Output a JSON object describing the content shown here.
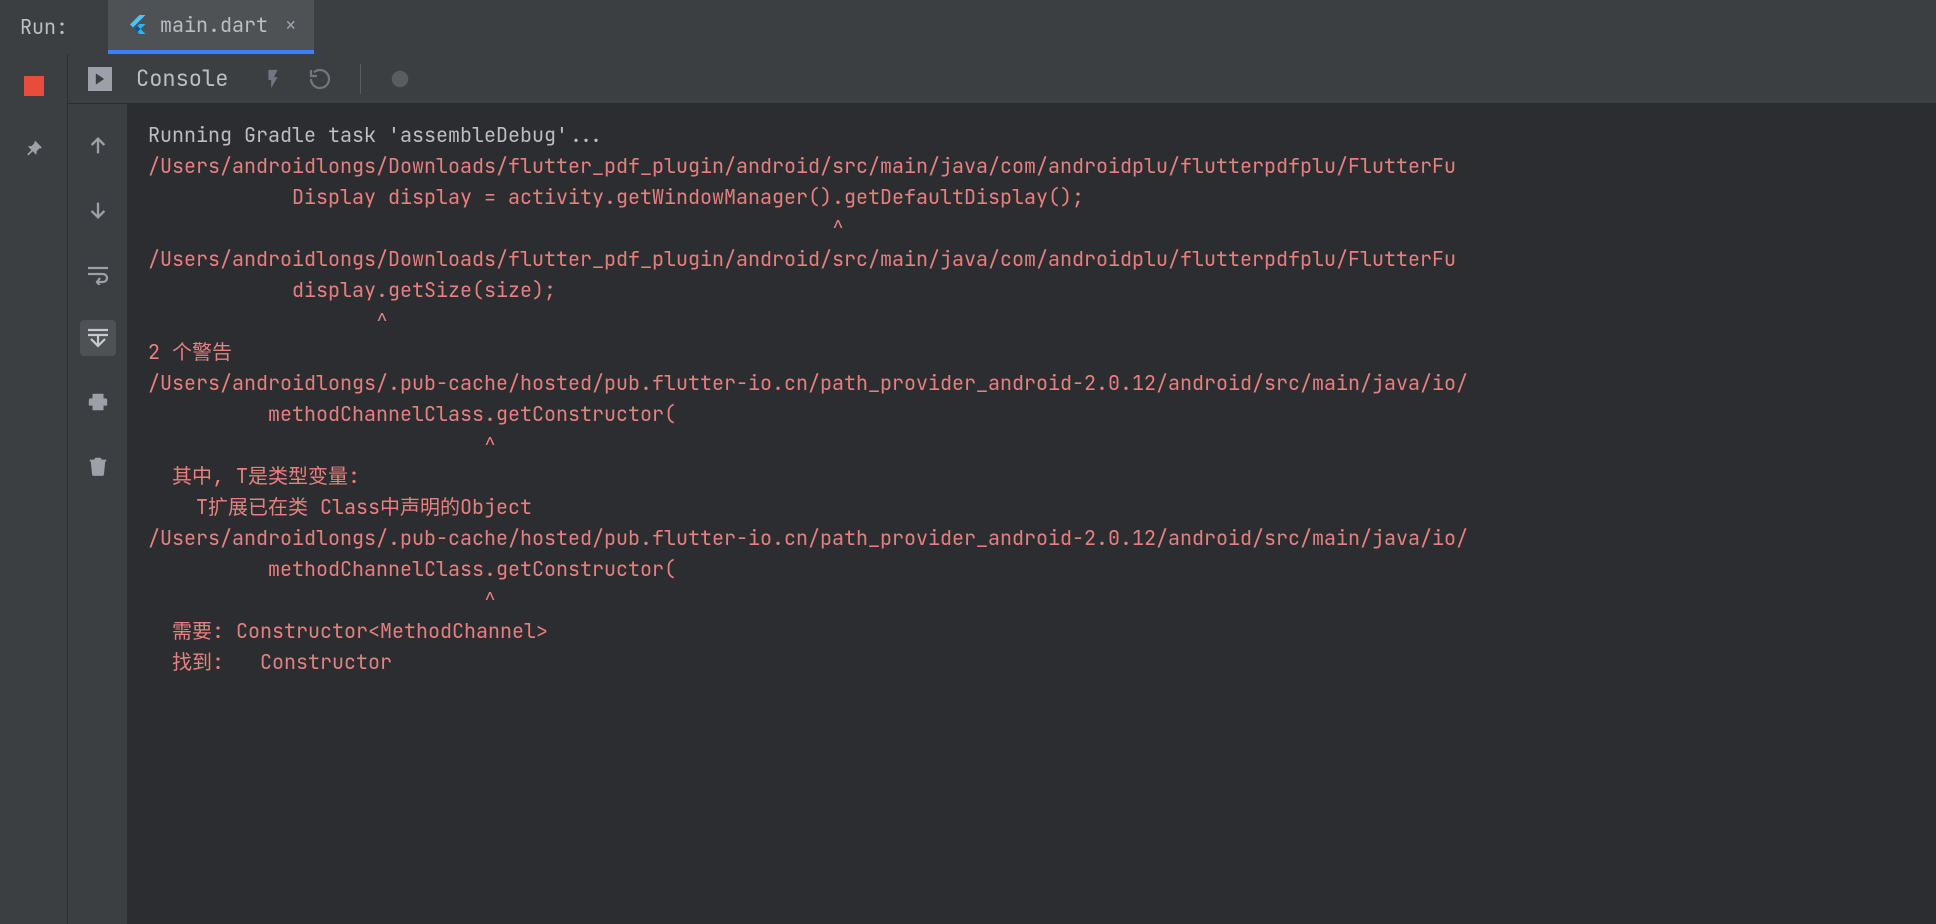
{
  "header": {
    "run_label": "Run:",
    "tab": {
      "label": "main.dart",
      "close": "×"
    }
  },
  "console_toolbar": {
    "label": "Console"
  },
  "output": {
    "lines": [
      {
        "cls": "line-normal",
        "text": "Running Gradle task 'assembleDebug'..."
      },
      {
        "cls": "line-error",
        "text": "/Users/androidlongs/Downloads/flutter_pdf_plugin/android/src/main/java/com/androidplu/flutterpdfplu/FlutterFu"
      },
      {
        "cls": "line-error",
        "text": "            Display display = activity.getWindowManager().getDefaultDisplay();"
      },
      {
        "cls": "line-error",
        "text": "                                                         ^"
      },
      {
        "cls": "line-error",
        "text": "/Users/androidlongs/Downloads/flutter_pdf_plugin/android/src/main/java/com/androidplu/flutterpdfplu/FlutterFu"
      },
      {
        "cls": "line-error",
        "text": "            display.getSize(size);"
      },
      {
        "cls": "line-error",
        "text": "                   ^"
      },
      {
        "cls": "line-error",
        "text": "2 个警告"
      },
      {
        "cls": "line-error",
        "text": "/Users/androidlongs/.pub-cache/hosted/pub.flutter-io.cn/path_provider_android-2.0.12/android/src/main/java/io/"
      },
      {
        "cls": "line-error",
        "text": "          methodChannelClass.getConstructor("
      },
      {
        "cls": "line-error",
        "text": "                            ^"
      },
      {
        "cls": "line-error",
        "text": "  其中, T是类型变量:"
      },
      {
        "cls": "line-error",
        "text": "    T扩展已在类 Class中声明的Object"
      },
      {
        "cls": "line-error",
        "text": "/Users/androidlongs/.pub-cache/hosted/pub.flutter-io.cn/path_provider_android-2.0.12/android/src/main/java/io/"
      },
      {
        "cls": "line-error",
        "text": "          methodChannelClass.getConstructor("
      },
      {
        "cls": "line-error",
        "text": "                            ^"
      },
      {
        "cls": "line-error",
        "text": "  需要: Constructor<MethodChannel>"
      },
      {
        "cls": "line-error",
        "text": "  找到:   Constructor"
      }
    ]
  }
}
